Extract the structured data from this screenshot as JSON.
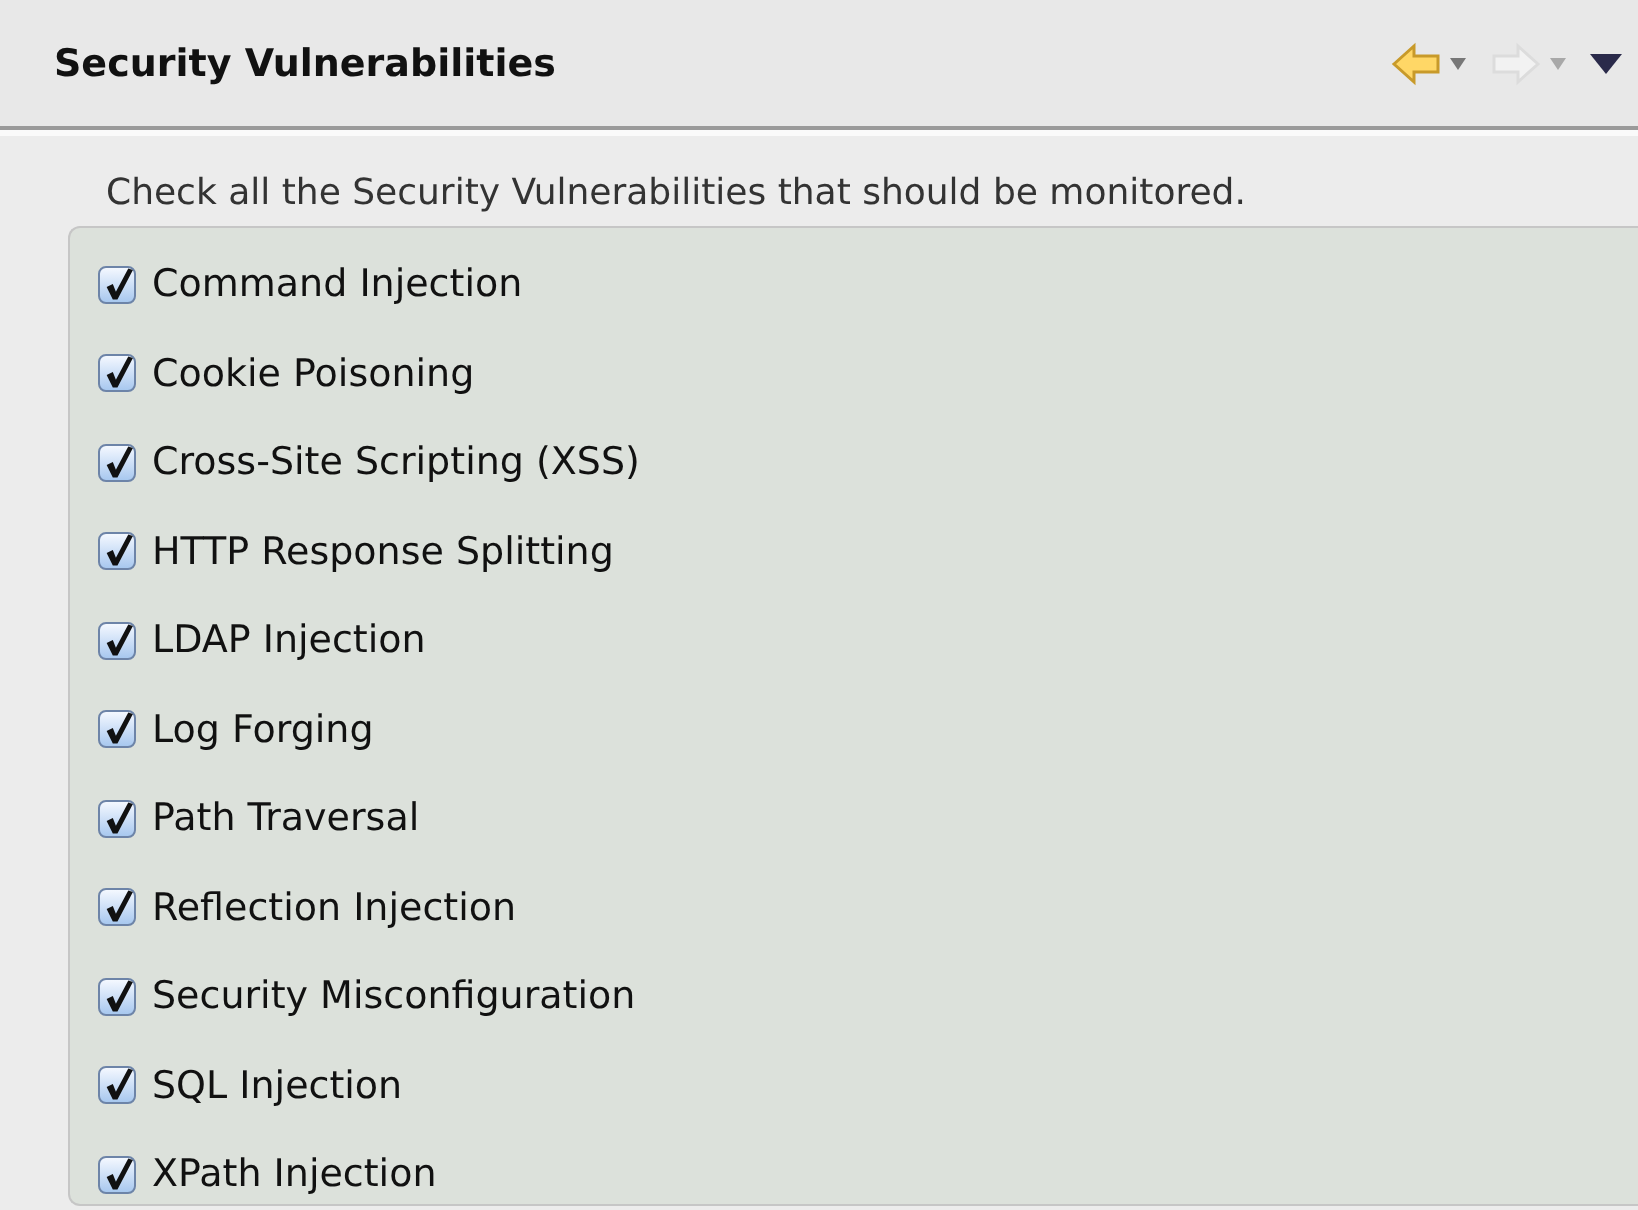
{
  "view": {
    "title": "Security Vulnerabilities"
  },
  "toolbar": [
    {
      "kind": "back",
      "disabled": false
    },
    {
      "kind": "forward",
      "disabled": true
    }
  ],
  "instruction": "Check all the Security Vulnerabilities that should be monitored.",
  "items": [
    {
      "label": "Command Injection",
      "checked": true
    },
    {
      "label": "Cookie Poisoning",
      "checked": true
    },
    {
      "label": "Cross-Site Scripting (XSS)",
      "checked": true
    },
    {
      "label": "HTTP Response Splitting",
      "checked": true
    },
    {
      "label": "LDAP Injection",
      "checked": true
    },
    {
      "label": "Log Forging",
      "checked": true
    },
    {
      "label": "Path Traversal",
      "checked": true
    },
    {
      "label": "Reflection Injection",
      "checked": true
    },
    {
      "label": "Security Misconfiguration",
      "checked": true
    },
    {
      "label": "SQL Injection",
      "checked": true
    },
    {
      "label": "XPath Injection",
      "checked": true
    }
  ]
}
